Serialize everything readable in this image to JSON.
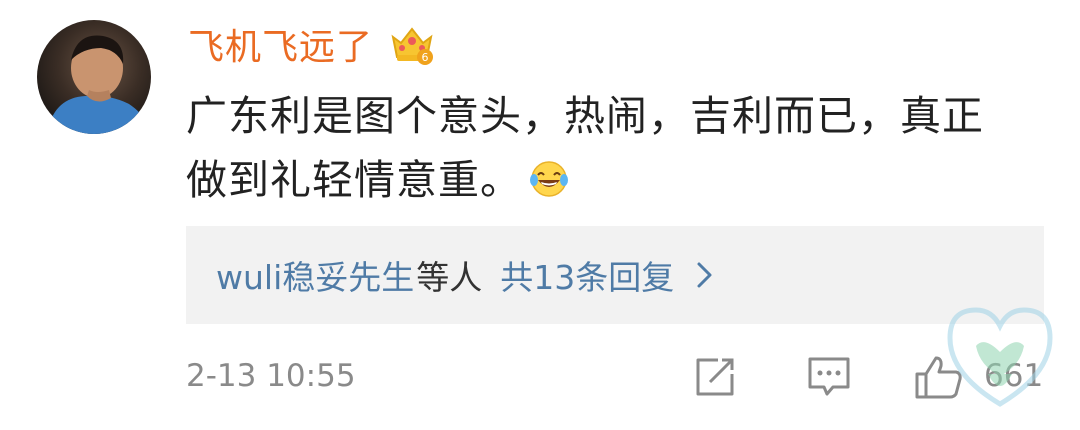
{
  "comment": {
    "username": "飞机飞远了",
    "badge_icon": "crown-level-6-icon",
    "badge_level": "6",
    "text_line1": "广东利是图个意头，热闹，吉利而已，真正",
    "text_line2": "做到礼轻情意重。",
    "inline_emoji": "laughing-tears-emoji",
    "replies": {
      "user": "wuli稳妥先生",
      "others_label": "等人",
      "total_label": "共13条回复"
    },
    "timestamp": "2-13 10:55",
    "like_count": "661"
  },
  "colors": {
    "username": "#ea6b23",
    "link": "#4f7ba6",
    "muted": "#8a8a8a",
    "reply_bg": "#f2f2f2"
  }
}
